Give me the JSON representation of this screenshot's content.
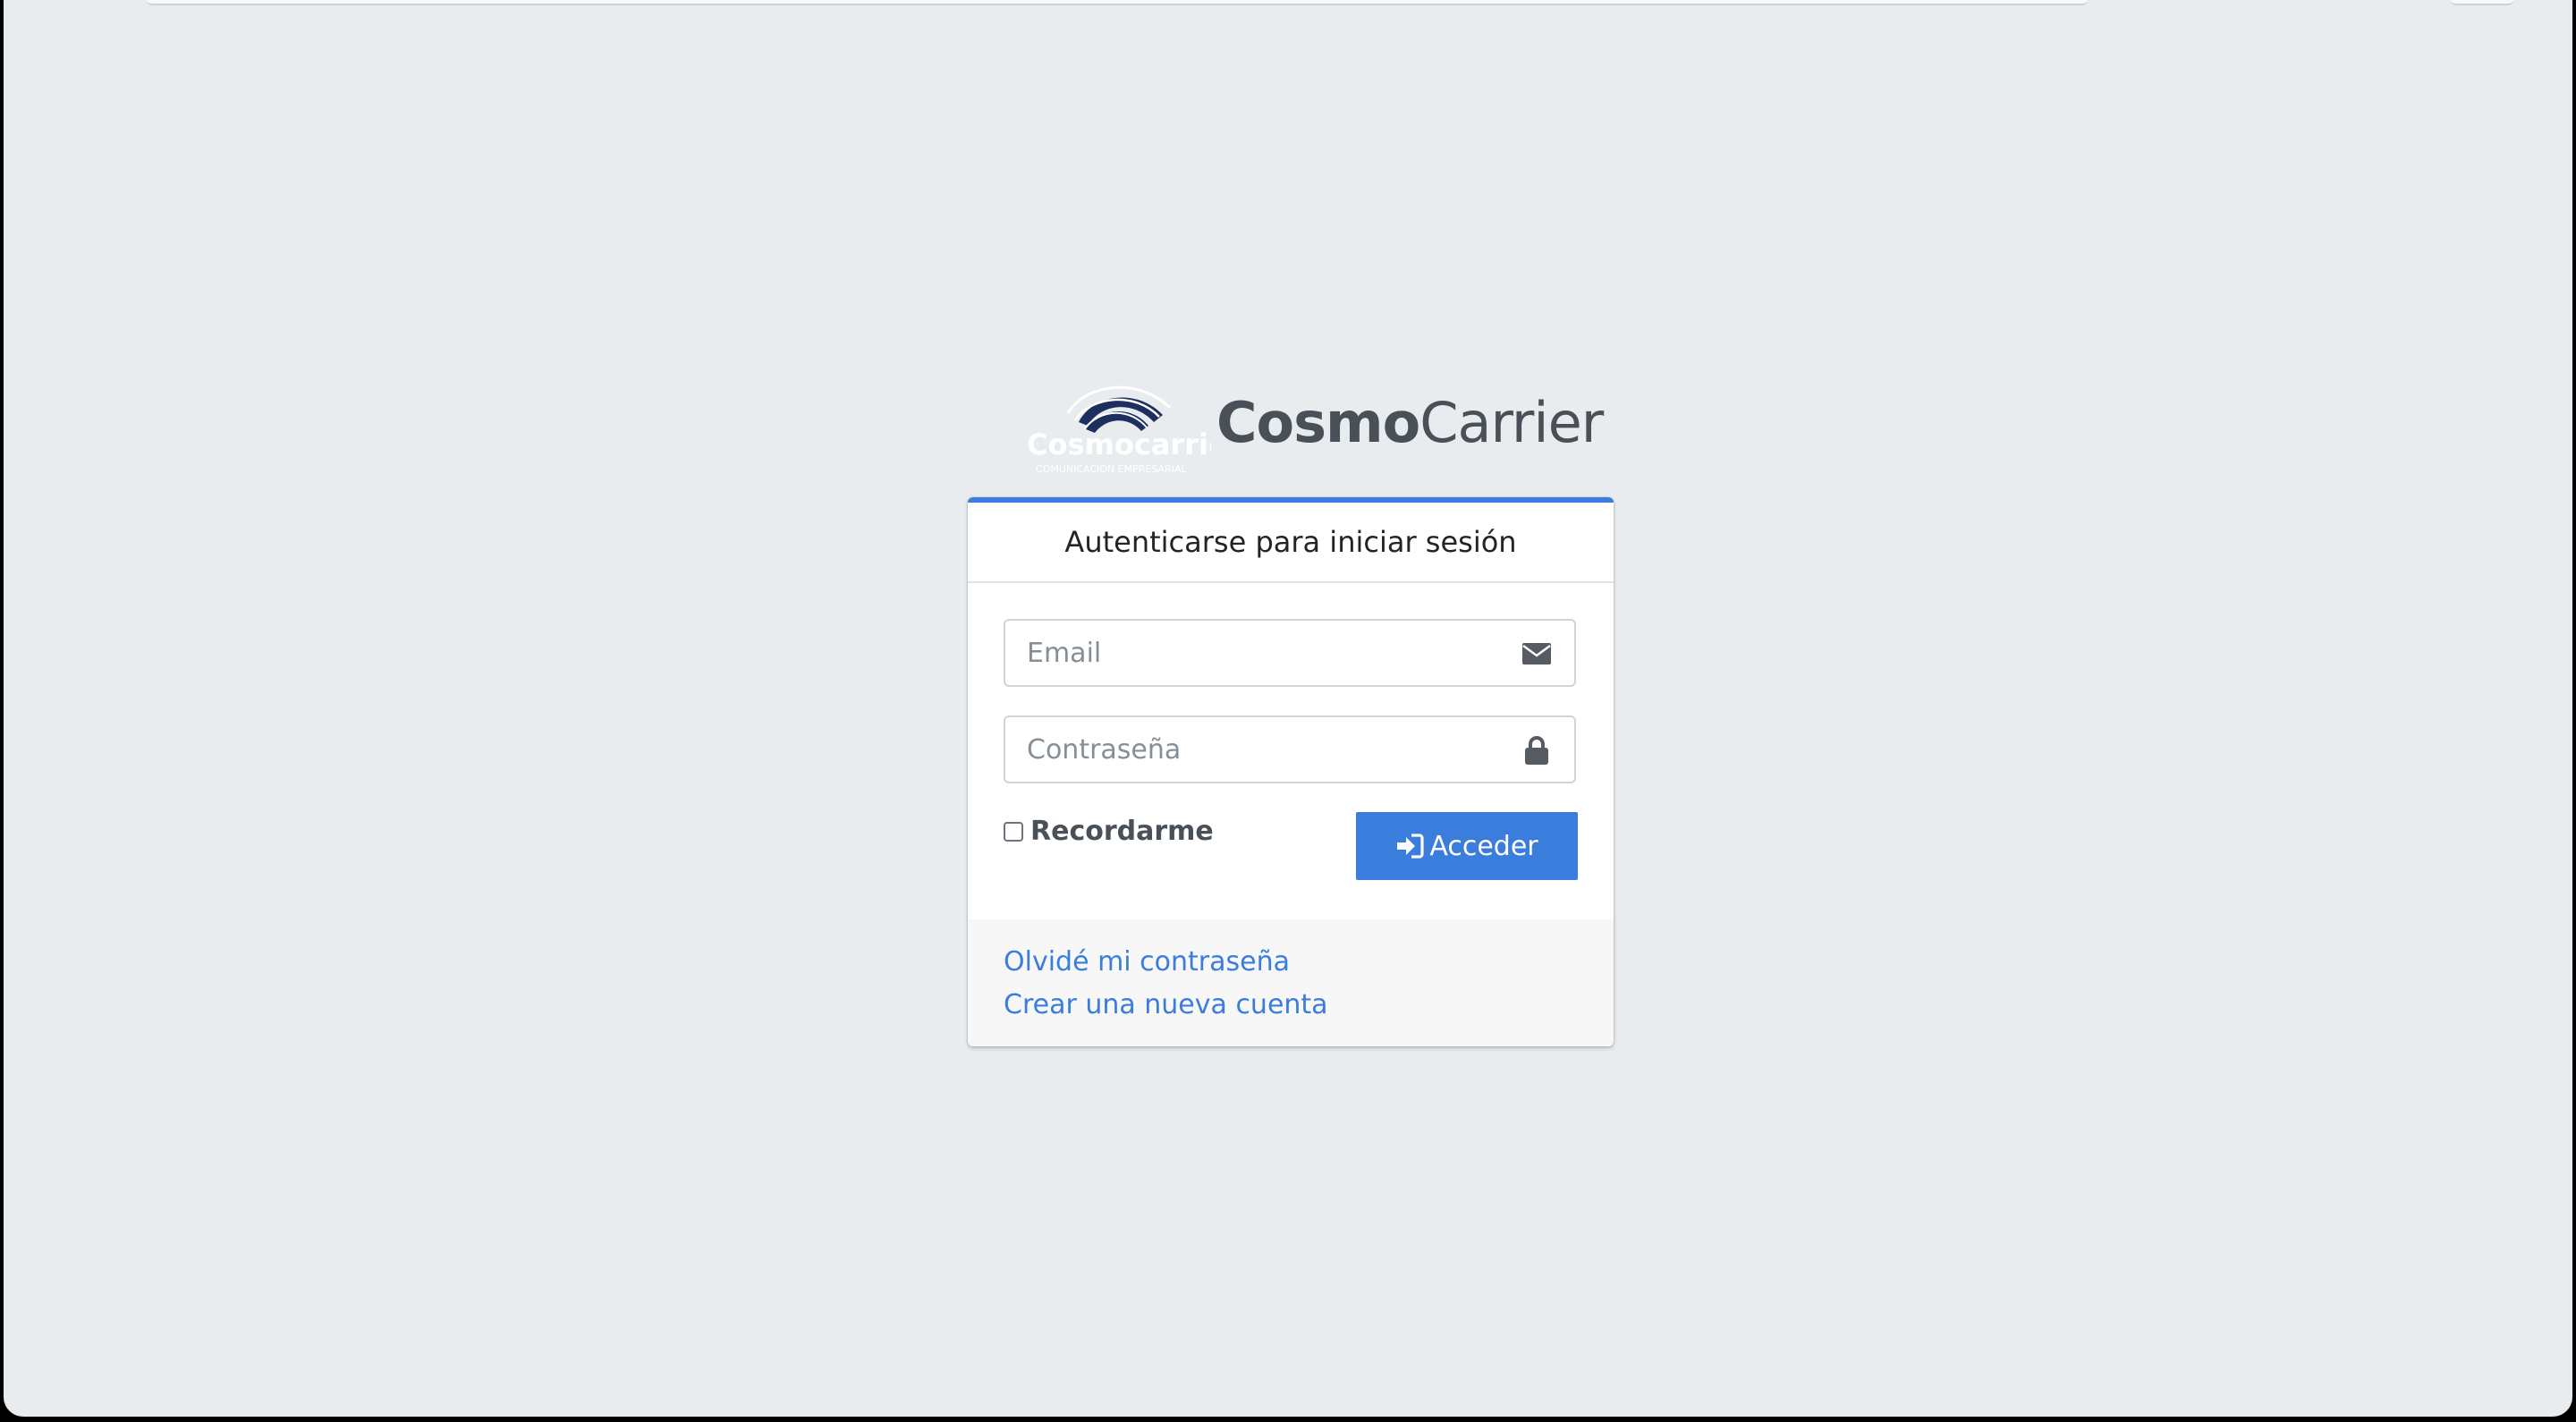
{
  "brand": {
    "logo_text": "Cosmocarrier",
    "logo_tagline": "COMUNICACIÓN EMPRESARIAL",
    "name_bold": "Cosmo",
    "name_light": "Carrier"
  },
  "login": {
    "header": "Autenticarse para iniciar sesión",
    "email_placeholder": "Email",
    "password_placeholder": "Contraseña",
    "remember_label": "Recordarme",
    "remember_checked": false,
    "submit_label": "Acceder",
    "forgot_link": "Olvidé mi contraseña",
    "register_link": "Crear una nueva cuenta"
  },
  "icons": {
    "email": "envelope-icon",
    "password": "lock-icon",
    "submit": "sign-in-icon"
  },
  "colors": {
    "accent": "#3b7ddd",
    "background": "#e9ecef",
    "logo_navy": "#1c2f5e"
  }
}
